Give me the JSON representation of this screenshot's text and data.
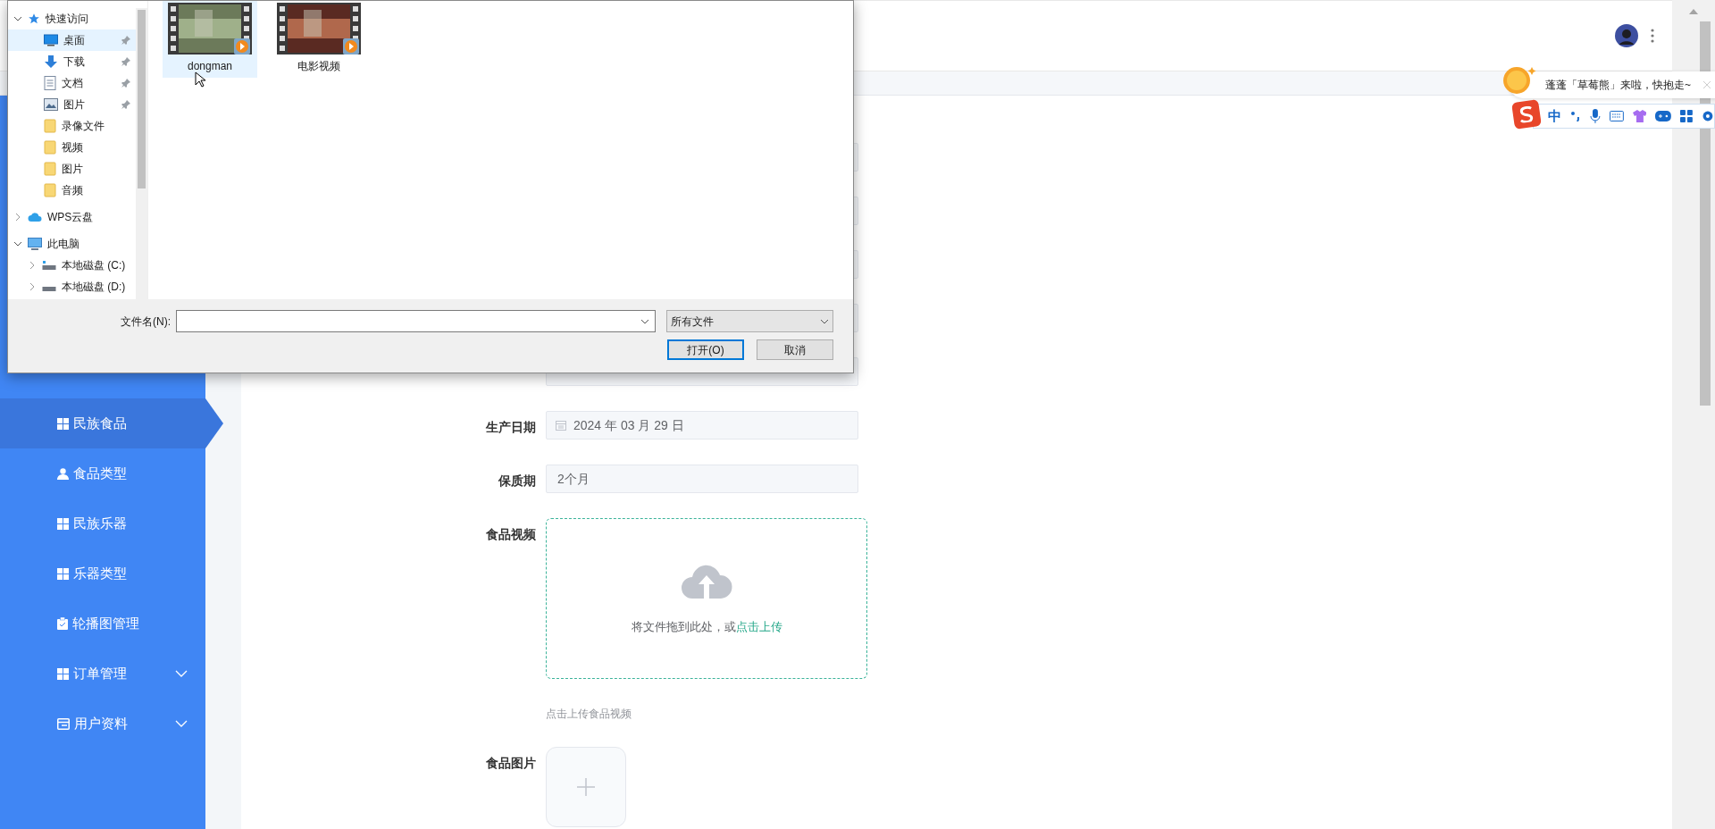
{
  "file_dialog": {
    "nav": [
      {
        "label": "快速访问",
        "kind": "star",
        "expanded": true,
        "children": [
          {
            "label": "桌面",
            "kind": "desktop",
            "pinned": true,
            "selected": true
          },
          {
            "label": "下载",
            "kind": "download",
            "pinned": true,
            "selected": false
          },
          {
            "label": "文档",
            "kind": "document",
            "pinned": true,
            "selected": false
          },
          {
            "label": "图片",
            "kind": "image",
            "pinned": true,
            "selected": false
          },
          {
            "label": "录像文件",
            "kind": "folder",
            "pinned": false,
            "selected": false
          },
          {
            "label": "视频",
            "kind": "folder",
            "pinned": false,
            "selected": false
          },
          {
            "label": "图片",
            "kind": "folder",
            "pinned": false,
            "selected": false
          },
          {
            "label": "音频",
            "kind": "folder",
            "pinned": false,
            "selected": false
          }
        ]
      },
      {
        "label": "WPS云盘",
        "kind": "cloud",
        "expanded": false
      },
      {
        "label": "此电脑",
        "kind": "computer",
        "expanded": true,
        "children": [
          {
            "label": "本地磁盘 (C:)",
            "kind": "system_drive",
            "expanded": false,
            "selected": false
          },
          {
            "label": "本地磁盘 (D:)",
            "kind": "drive",
            "expanded": false,
            "selected": false
          }
        ]
      }
    ],
    "files": [
      {
        "name": "dongman",
        "selected": true
      },
      {
        "name": "电影视频",
        "selected": false
      }
    ],
    "filename_label": "文件名(N):",
    "file_type": "所有文件",
    "buttons": [
      {
        "label": "打开(O)",
        "default": true
      },
      {
        "label": "取消",
        "default": false
      }
    ]
  },
  "sidebar": {
    "items": [
      {
        "label": "民族食品",
        "kind": "link",
        "selected": true
      },
      {
        "label": "食品类型",
        "kind": "link",
        "selected": false
      },
      {
        "label": "民族乐器",
        "kind": "link",
        "selected": false
      },
      {
        "label": "乐器类型",
        "kind": "link",
        "selected": false
      },
      {
        "label": "轮播图管理",
        "kind": "link",
        "selected": false
      },
      {
        "label": "订单管理",
        "kind": "submenu",
        "expanded": false,
        "selected": false
      },
      {
        "label": "用户资料",
        "kind": "submenu",
        "expanded": false,
        "selected": false
      }
    ]
  },
  "form": {
    "fields": [
      {
        "label": "生产日期",
        "kind": "date",
        "value": "2024 年 03 月 29 日"
      },
      {
        "label": "保质期",
        "kind": "text",
        "value": "2个月"
      },
      {
        "label": "食品视频",
        "kind": "video_upload",
        "prompt": "将文件拖到此处，或",
        "link": "点击上传",
        "hint": "点击上传食品视频"
      },
      {
        "label": "食品图片",
        "kind": "image_upload"
      }
    ]
  },
  "ime": {
    "bubble": "蓬蓬「草莓熊」来啦，快抱走~",
    "mode": "中"
  }
}
